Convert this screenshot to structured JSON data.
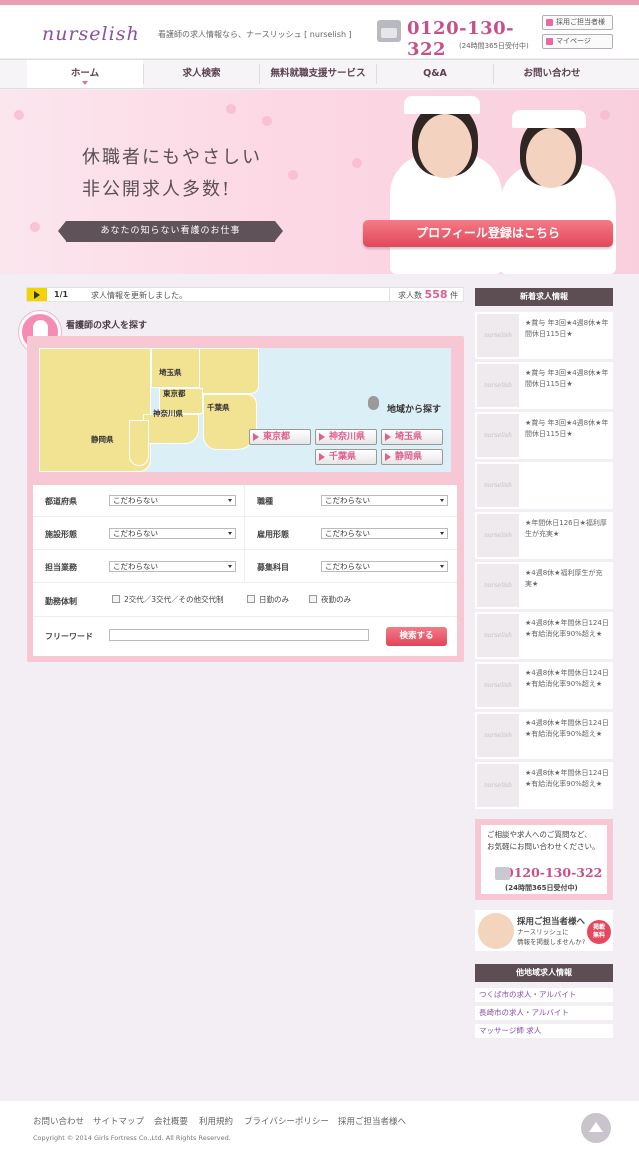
{
  "header": {
    "logo": "nurselish",
    "tagline": "看護師の求人情報なら、ナースリッシュ [ nurselish ]",
    "phone": "0120-130-322",
    "phone_note": "(24時間365日受付中)",
    "recruiter_button": "採用ご担当者様",
    "mypage_button": "マイページ"
  },
  "nav": {
    "items": [
      "ホーム",
      "求人検索",
      "無料就職支援サービス",
      "Q&A",
      "お問い合わせ"
    ]
  },
  "hero": {
    "line1": "休職者にもやさしい",
    "line2": "非公開求人多数!",
    "ribbon": "あなたの知らない看護のお仕事",
    "cta": "プロフィール登録はこちら"
  },
  "ticker": {
    "count": "1/1",
    "message": "求人情報を更新しました。",
    "total_label": "求人数",
    "total_value": "558",
    "total_unit": "件"
  },
  "search": {
    "title": "看護師の求人を探す",
    "map_labels": [
      "埼玉県",
      "東京都",
      "千葉県",
      "神奈川県",
      "静岡県"
    ],
    "region_title": "地域から探す",
    "prefectures": [
      "東京都",
      "神奈川県",
      "埼玉県",
      "千葉県",
      "静岡県"
    ],
    "fields": {
      "pref_label": "都道府県",
      "pref_value": "こだわらない",
      "job_label": "職種",
      "job_value": "こだわらない",
      "facility_label": "施設形態",
      "facility_value": "こだわらない",
      "employment_label": "雇用形態",
      "employment_value": "こだわらない",
      "duty_label": "担当業務",
      "duty_value": "こだわらない",
      "dept_label": "募集科目",
      "dept_value": "こだわらない",
      "shift_label": "勤務体制",
      "shift_options": [
        "2交代／3交代／その他交代制",
        "日勤のみ",
        "夜勤のみ"
      ],
      "freeword_label": "フリーワード"
    },
    "submit": "検索する"
  },
  "sidebar": {
    "new_jobs_title": "新着求人情報",
    "thumb_text": "nurselish",
    "jobs": [
      "★賞与 年3回★4週8休★年間休日115日★",
      "★賞与 年3回★4週8休★年間休日115日★",
      "★賞与 年3回★4週8休★年間休日115日★",
      "",
      "★年間休日126日★福利厚生が充実★",
      "★4週8休★福利厚生が充実★",
      "★4週8休★年間休日124日★有給消化率90%超え★",
      "★4週8休★年間休日124日★有給消化率90%超え★",
      "★4週8休★年間休日124日★有給消化率90%超え★",
      "★4週8休★年間休日124日★有給消化率90%超え★"
    ],
    "contact_text1": "ご相談や求人へのご質問など、",
    "contact_text2": "お気軽にお問い合わせください。",
    "contact_phone": "0120-130-322",
    "contact_note": "(24時間365日受付中)",
    "recruit_title": "採用ご担当者様へ",
    "recruit_text1": "ナースリッシュに",
    "recruit_text2": "情報を掲載しませんか?",
    "recruit_badge1": "掲載",
    "recruit_badge2": "無料",
    "other_areas_title": "他地域求人情報",
    "other_areas": [
      "つくば市の求人・アルバイト",
      "長崎市の求人・アルバイト",
      "マッサージ師 求人"
    ]
  },
  "footer": {
    "links": [
      "お問い合わせ",
      "サイトマップ",
      "会社概要",
      "利用規約",
      "プライバシーポリシー",
      "採用ご担当者様へ"
    ],
    "copyright": "Copyright © 2014 Girls Fortress Co.,Ltd. All Rights Reserved."
  }
}
